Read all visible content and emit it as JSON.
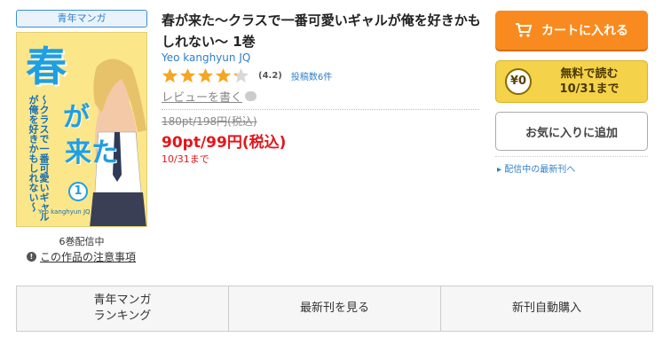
{
  "badge": "青年マンガ",
  "cover": {
    "title_big": "春",
    "title_ga": "が",
    "title_kita": "来た",
    "subtitle": "〜クラスで一番可愛いギャルが俺を好きかもしれない〜",
    "volume": "1",
    "author_strip": "Yeo kanghyun JQ"
  },
  "issued": "6巻配信中",
  "notice": "この作品の注意事項",
  "title": "春が来た〜クラスで一番可愛いギャルが俺を好きかもしれない〜 1巻",
  "author": "Yeo kanghyun JQ",
  "rating": {
    "value": 4.2,
    "label": "(4.2)",
    "reviews": "投稿数6件",
    "star_color": "#f5a623",
    "empty_color": "#d8d8d8"
  },
  "write_review": "レビューを書く",
  "price_old": "180pt/198円(税込)",
  "price_new": "90pt/99円(税込)",
  "until": "10/31まで",
  "buttons": {
    "cart": "カートに入れる",
    "free_icon": "¥0",
    "free_line1": "無料で読む",
    "free_line2": "10/31まで",
    "favorite": "お気に入りに追加"
  },
  "latest_link": "▸ 配信中の最新刊へ",
  "tabs": [
    {
      "label": "青年マンガ\nランキング"
    },
    {
      "label": "最新刊を見る"
    },
    {
      "label": "新刊自動購入"
    }
  ],
  "colors": {
    "accent_orange": "#f98a1f",
    "price_red": "#e3161b",
    "link_blue": "#2f7fc8",
    "free_yellow": "#f4d24a"
  }
}
